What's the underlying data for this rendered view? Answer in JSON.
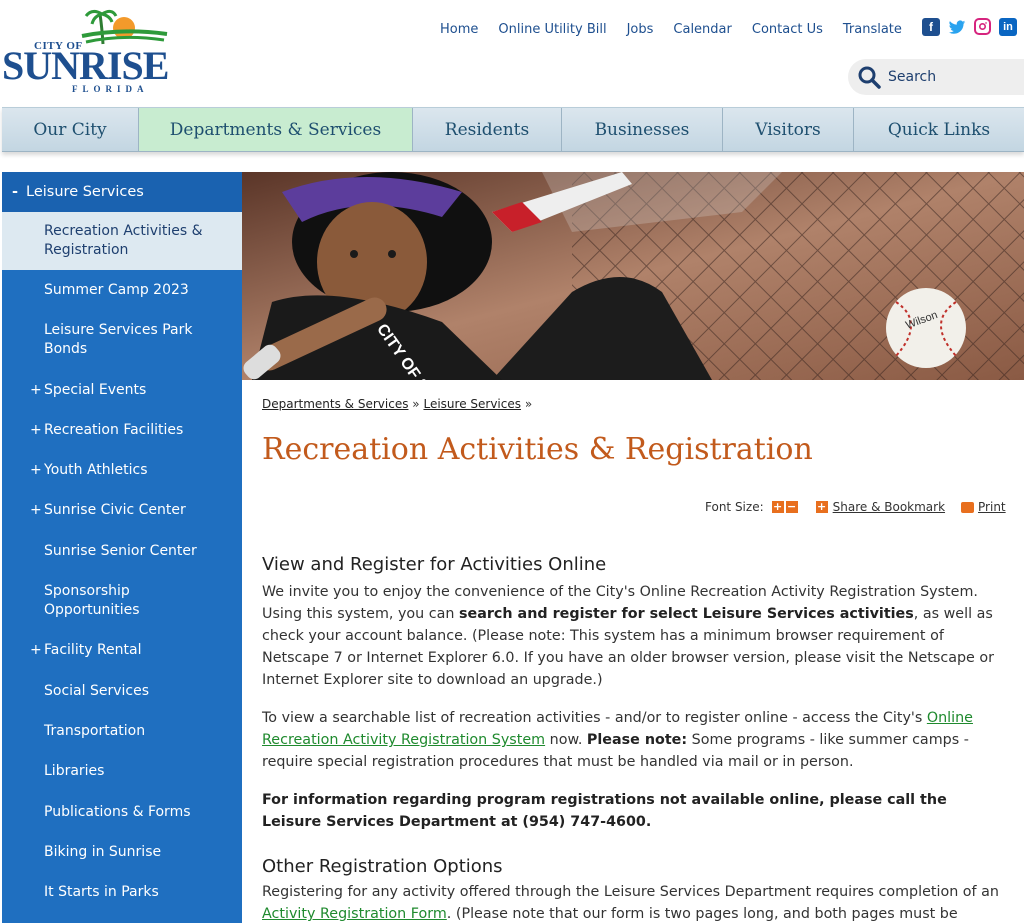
{
  "logo": {
    "city_of": "CITY OF",
    "name": "SUNRISE",
    "state": "FLORIDA"
  },
  "top_links": [
    "Home",
    "Online Utility Bill",
    "Jobs",
    "Calendar",
    "Contact Us",
    "Translate"
  ],
  "social": {
    "facebook": "f",
    "twitter": "🐦",
    "instagram": "◎",
    "linkedin": "in"
  },
  "search": {
    "label": "Search"
  },
  "main_nav": [
    {
      "label": "Our City"
    },
    {
      "label": "Departments & Services"
    },
    {
      "label": "Residents"
    },
    {
      "label": "Businesses"
    },
    {
      "label": "Visitors"
    },
    {
      "label": "Quick Links"
    }
  ],
  "sidebar": {
    "header": "Leisure Services",
    "header_sign": "-",
    "items": [
      {
        "label": "Recreation Activities & Registration",
        "expandable": false
      },
      {
        "label": "Summer Camp 2023",
        "expandable": false
      },
      {
        "label": "Leisure Services Park Bonds",
        "expandable": false
      },
      {
        "label": "Special Events",
        "expandable": true
      },
      {
        "label": "Recreation Facilities",
        "expandable": true
      },
      {
        "label": "Youth Athletics",
        "expandable": true
      },
      {
        "label": "Sunrise Civic Center",
        "expandable": true
      },
      {
        "label": "Sunrise Senior Center",
        "expandable": false
      },
      {
        "label": "Sponsorship Opportunities",
        "expandable": false
      },
      {
        "label": "Facility Rental",
        "expandable": true
      },
      {
        "label": "Social Services",
        "expandable": false
      },
      {
        "label": "Transportation",
        "expandable": false
      },
      {
        "label": "Libraries",
        "expandable": false
      },
      {
        "label": "Publications & Forms",
        "expandable": false
      },
      {
        "label": "Biking in Sunrise",
        "expandable": false
      },
      {
        "label": "It Starts in Parks",
        "expandable": false
      }
    ],
    "plus_sign": "+"
  },
  "hero": {
    "ball_text": "Wilson",
    "shirt_text": "CITY OF SUNRISE"
  },
  "breadcrumb": {
    "item1": "Departments & Services",
    "sep": "»",
    "item2": "Leisure Services"
  },
  "page_title": "Recreation Activities & Registration",
  "tools": {
    "font_size": "Font Size:",
    "increase": "+",
    "decrease": "−",
    "share_icon": "+",
    "share": "Share & Bookmark",
    "print": "Print"
  },
  "section1": {
    "title": "View and Register for Activities Online",
    "p1_a": "We invite you to enjoy the convenience of the City's Online Recreation Activity Registration System. Using this system, you can ",
    "p1_b": "search and register for select Leisure Services activities",
    "p1_c": ", as well as check your account balance. (Please note: This system has a minimum browser requirement of Netscape 7 or Internet Explorer 6.0. If you have an older browser version, please visit the Netscape or Internet Explorer site to download an upgrade.)",
    "p2_a": "To view a searchable list of recreation activities - and/or to register online - access the City's ",
    "p2_link": "Online Recreation Activity Registration System",
    "p2_b": " now.  ",
    "p2_bold": "Please note:",
    "p2_c": " Some programs - like summer camps - require special registration procedures that must be handled via mail or in person.",
    "p3": "For information regarding program registrations not available online, please call the Leisure Services Department at (954) 747-4600."
  },
  "section2": {
    "title": "Other Registration Options",
    "p1_a": "Registering for any activity offered through the Leisure Services Department requires completion of an ",
    "p1_link": "Activity Registration Form",
    "p1_b": ". (Please note that our form is two pages long, and both pages must be"
  }
}
